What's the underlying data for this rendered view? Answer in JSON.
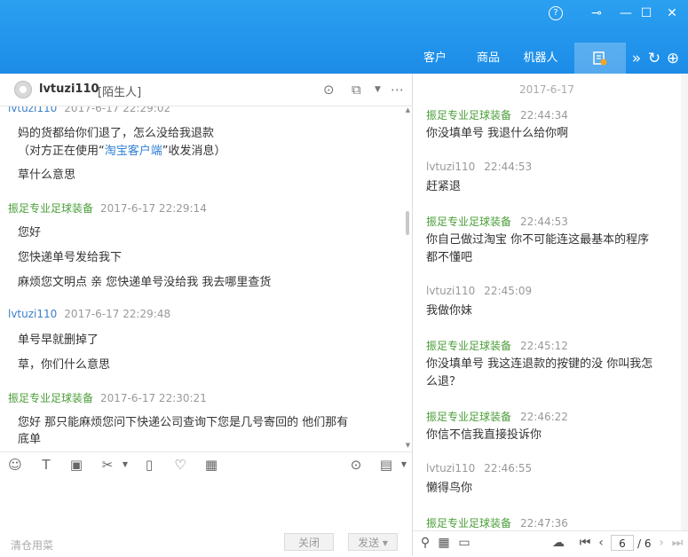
{
  "window": {
    "help_icon": "?",
    "pin_icon": "⊸",
    "minimize_icon": "—",
    "maximize_icon": "☐",
    "close_icon": "✕"
  },
  "top_tabs": [
    {
      "label": "客户"
    },
    {
      "label": "商品"
    },
    {
      "label": "机器人"
    }
  ],
  "chat": {
    "name": "lvtuzi110",
    "tag": "[陌生人]",
    "messages": {
      "m0_sender": "lvtuzi110",
      "m0_time": "2017-6-17 22:29:02",
      "m0_line1": "妈的货都给你们退了，怎么没给我退款",
      "m0_line2_pre": "（对方正在使用“",
      "m0_line2_link": "淘宝客户端",
      "m0_line2_post": "”收发消息）",
      "m0_line3": "草什么意思",
      "m1_sender": "振足专业足球装备",
      "m1_time": "2017-6-17 22:29:14",
      "m1_line1": "您好",
      "m1_line2": "您快递单号发给我下",
      "m1_line3": "麻烦您文明点 亲  您快递单号没给我 我去哪里查货",
      "m2_sender": "lvtuzi110",
      "m2_time": "2017-6-17 22:29:48",
      "m2_line1": "单号早就删掉了",
      "m2_line2": "草，你们什么意思",
      "m3_sender": "振足专业足球装备",
      "m3_time": "2017-6-17 22:30:21",
      "m3_line1": "您好 那只能麻烦您问下快递公司查询下您是几号寄回的 他们那有",
      "m3_line2": "底单"
    }
  },
  "composer": {
    "quick_reply": "清仓用菜",
    "close_label": "关闭",
    "send_label": "发送"
  },
  "history": {
    "date": "2017-6-17",
    "entries": [
      {
        "sender": "振足专业足球装备",
        "time": "22:44:34",
        "text": "你没填单号 我退什么给你啊"
      },
      {
        "sender": "lvtuzi110",
        "time": "22:44:53",
        "text": "赶紧退"
      },
      {
        "sender": "振足专业足球装备",
        "time": "22:44:53",
        "text": "你自己做过淘宝  你不可能连这最基本的程序都不懂吧"
      },
      {
        "sender": "lvtuzi110",
        "time": "22:45:09",
        "text": "我做你妹"
      },
      {
        "sender": "振足专业足球装备",
        "time": "22:45:12",
        "text": "你没填单号 我这连退款的按键的没  你叫我怎么退？"
      },
      {
        "sender": "振足专业足球装备",
        "time": "22:46:22",
        "text": "你信不信我直接投诉你"
      },
      {
        "sender": "lvtuzi110",
        "time": "22:46:55",
        "text": "懒得鸟你"
      },
      {
        "sender": "振足专业足球装备",
        "time": "22:47:36",
        "text": ""
      }
    ],
    "page_current": "6",
    "page_total": "/ 6"
  },
  "colors": {
    "titlebar": "#1c8ce8",
    "seller_name": "#4c9e3a",
    "buyer_name_left": "#3d7fc8",
    "link": "#2e7fd4"
  }
}
